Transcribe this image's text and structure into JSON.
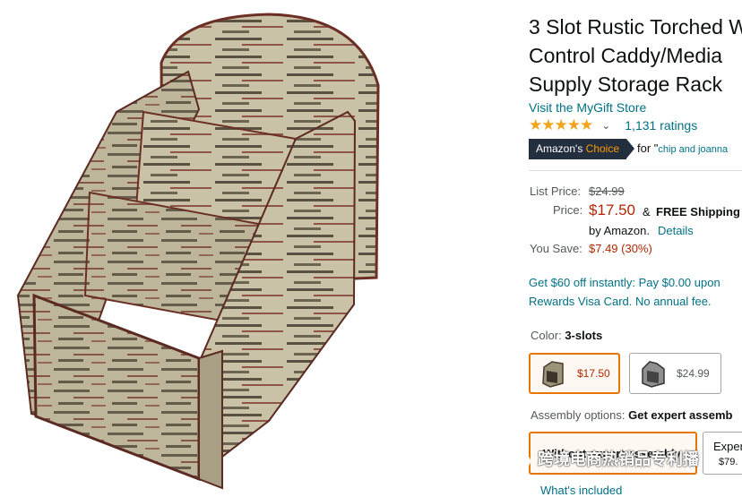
{
  "product": {
    "title_lines": [
      "3 Slot Rustic Torched W",
      "Control Caddy/Media",
      "Supply Storage Rack"
    ],
    "store_link": "Visit the MyGift Store",
    "stars": "★★★★★",
    "rating_count": "1,131 ratings",
    "badge_label_1": "Amazon's ",
    "badge_label_2": "Choice",
    "badge_for": "for \"",
    "badge_query": "chip and joanna"
  },
  "pricing": {
    "list_price_label": "List Price:",
    "list_price": "$24.99",
    "price_label": "Price:",
    "price": "$17.50",
    "shipping_amp": "&",
    "free_shipping": "FREE Shipping",
    "by": "by Amazon.",
    "details": "Details",
    "save_label": "You Save:",
    "save_value": "$7.49 (30%)"
  },
  "offer": {
    "line1": "Get $60 off instantly: Pay $0.00 upon",
    "line2": "Rewards Visa Card. No annual fee."
  },
  "color": {
    "label": "Color:",
    "selected": "3-slots",
    "options": [
      {
        "price": "$17.50"
      },
      {
        "price": "$24.99"
      }
    ]
  },
  "assembly": {
    "label": "Assembly options:",
    "selected": "Get expert assemb",
    "option1": "Without expert assembly",
    "option2_line1": "Expert",
    "option2_line2": "$79."
  },
  "whats_included": "What's included",
  "watermark": "跨境电商热销品专利播",
  "colors": {
    "link": "#007185",
    "price": "#b12704",
    "badge": "#232f3e",
    "selected_border": "#e77600",
    "star": "#f2a21b"
  }
}
